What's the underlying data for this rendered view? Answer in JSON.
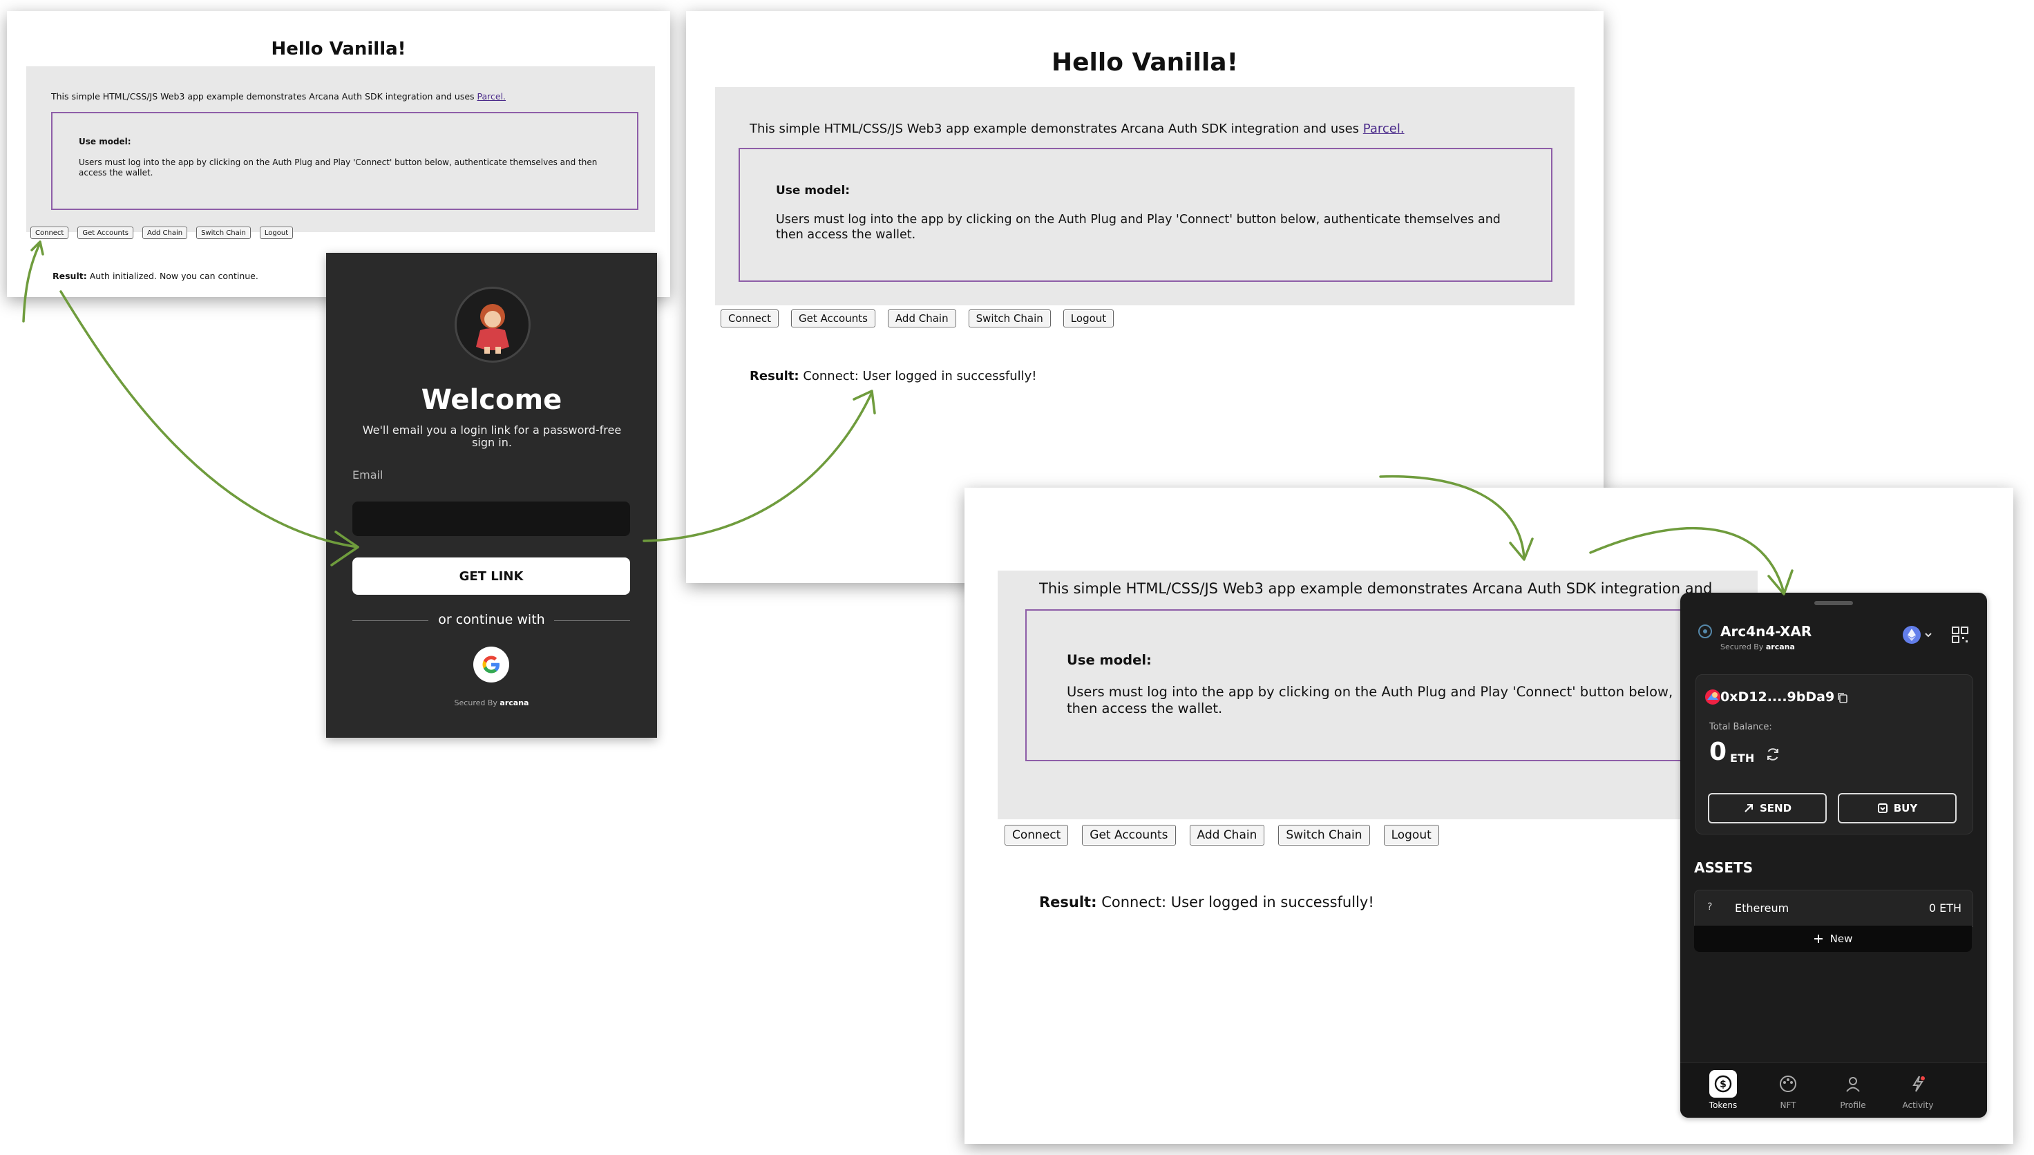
{
  "app": {
    "title": "Hello Vanilla!",
    "intro_text": "This simple HTML/CSS/JS Web3 app example demonstrates Arcana Auth SDK integration and uses ",
    "intro_link": "Parcel.",
    "intro_text_cropped": "This simple HTML/CSS/JS Web3 app example demonstrates Arcana Auth SDK integration and",
    "use_model_title": "Use model:",
    "use_model_body": "Users must log into the app by clicking on the Auth Plug and Play 'Connect' button below, authenticate themselves and then access the wallet.",
    "use_model_body_cropped_1": "Users must log into the app by clicking on the Auth Plug and Play 'Connect' button below,",
    "use_model_body_cropped_2": "then access the wallet.",
    "buttons": [
      "Connect",
      "Get Accounts",
      "Add Chain",
      "Switch Chain",
      "Logout"
    ],
    "result_label": "Result:",
    "result_initial": "Auth initialized. Now you can continue.",
    "result_connected": "Connect: User logged in successfully!"
  },
  "login": {
    "welcome": "Welcome",
    "subtitle": "We'll email you a login link for a password-free sign in.",
    "email_label": "Email",
    "email_value": "",
    "get_link": "GET LINK",
    "or_continue": "or continue with",
    "secured_by": "Secured By",
    "brand": "arcana"
  },
  "wallet": {
    "name": "Arc4n4-XAR",
    "secured_by": "Secured By",
    "brand": "arcana",
    "address": "0xD12....9bDa9",
    "total_balance_label": "Total Balance:",
    "balance": "0",
    "unit": "ETH",
    "send": "SEND",
    "buy": "BUY",
    "assets_title": "ASSETS",
    "asset_name": "Ethereum",
    "asset_amount": "0 ETH",
    "new_label": "New",
    "nav": [
      "Tokens",
      "NFT",
      "Profile",
      "Activity"
    ]
  },
  "colors": {
    "accent_border": "#8e5ea8",
    "arrow": "#6f9c3d",
    "wallet_bg": "#1c1c1c",
    "login_bg": "#2a2a2a"
  }
}
